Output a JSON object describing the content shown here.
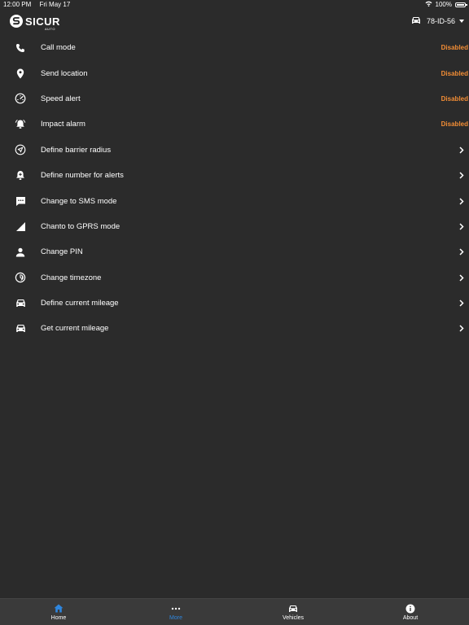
{
  "status_bar": {
    "time": "12:00 PM",
    "date": "Fri May 17",
    "battery": "100%"
  },
  "header": {
    "brand": "SICUR",
    "brand_sub": "AUTO",
    "vehicle_plate": "78-ID-56"
  },
  "settings": [
    {
      "label": "Call mode",
      "status": "Disabled",
      "icon": "phone-icon"
    },
    {
      "label": "Send location",
      "status": "Disabled",
      "icon": "location-pin-icon"
    },
    {
      "label": "Speed alert",
      "status": "Disabled",
      "icon": "speedometer-icon"
    },
    {
      "label": "Impact alarm",
      "status": "Disabled",
      "icon": "alarm-bell-icon"
    },
    {
      "label": "Define barrier radius",
      "icon": "navigation-arrow-icon"
    },
    {
      "label": "Define number for alerts",
      "icon": "notification-bell-icon"
    },
    {
      "label": "Change to SMS mode",
      "icon": "sms-icon"
    },
    {
      "label": "Chanto to GPRS mode",
      "icon": "signal-icon"
    },
    {
      "label": "Change PIN",
      "icon": "person-icon"
    },
    {
      "label": "Change timezone",
      "icon": "timezone-icon"
    },
    {
      "label": "Define current mileage",
      "icon": "car-icon"
    },
    {
      "label": "Get current mileage",
      "icon": "car-icon"
    }
  ],
  "tabs": [
    {
      "label": "Home",
      "icon": "home-icon",
      "active": false
    },
    {
      "label": "More",
      "icon": "more-dots-icon",
      "active": true
    },
    {
      "label": "Vehicles",
      "icon": "car-icon",
      "active": false
    },
    {
      "label": "About",
      "icon": "info-icon",
      "active": false
    }
  ],
  "colors": {
    "background": "#2b2b2b",
    "status_disabled": "#f28d35",
    "tab_active": "#2e86de",
    "tab_bar": "#3a3a3a"
  }
}
